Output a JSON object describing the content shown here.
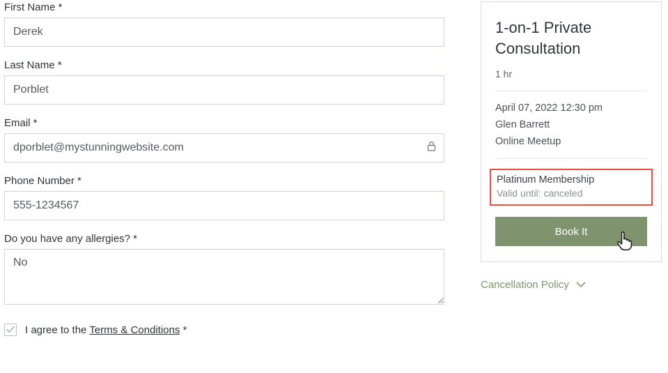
{
  "form": {
    "firstName": {
      "label": "First Name *",
      "value": "Derek"
    },
    "lastName": {
      "label": "Last Name *",
      "value": "Porblet"
    },
    "email": {
      "label": "Email *",
      "value": "dporblet@mystunningwebsite.com"
    },
    "phone": {
      "label": "Phone Number *",
      "value": "555-1234567"
    },
    "allergies": {
      "label": "Do you have any allergies? *",
      "value": "No"
    },
    "terms": {
      "prefix": "I agree to the ",
      "link": "Terms & Conditions",
      "suffix": " *"
    }
  },
  "summary": {
    "title": "1-on-1 Private Consultation",
    "duration": "1 hr",
    "datetime": "April 07, 2022 12:30 pm",
    "provider": "Glen Barrett",
    "location": "Online Meetup",
    "membershipName": "Platinum Membership",
    "membershipValid": "Valid until: canceled",
    "bookLabel": "Book It"
  },
  "cancellation": {
    "label": "Cancellation Policy"
  }
}
